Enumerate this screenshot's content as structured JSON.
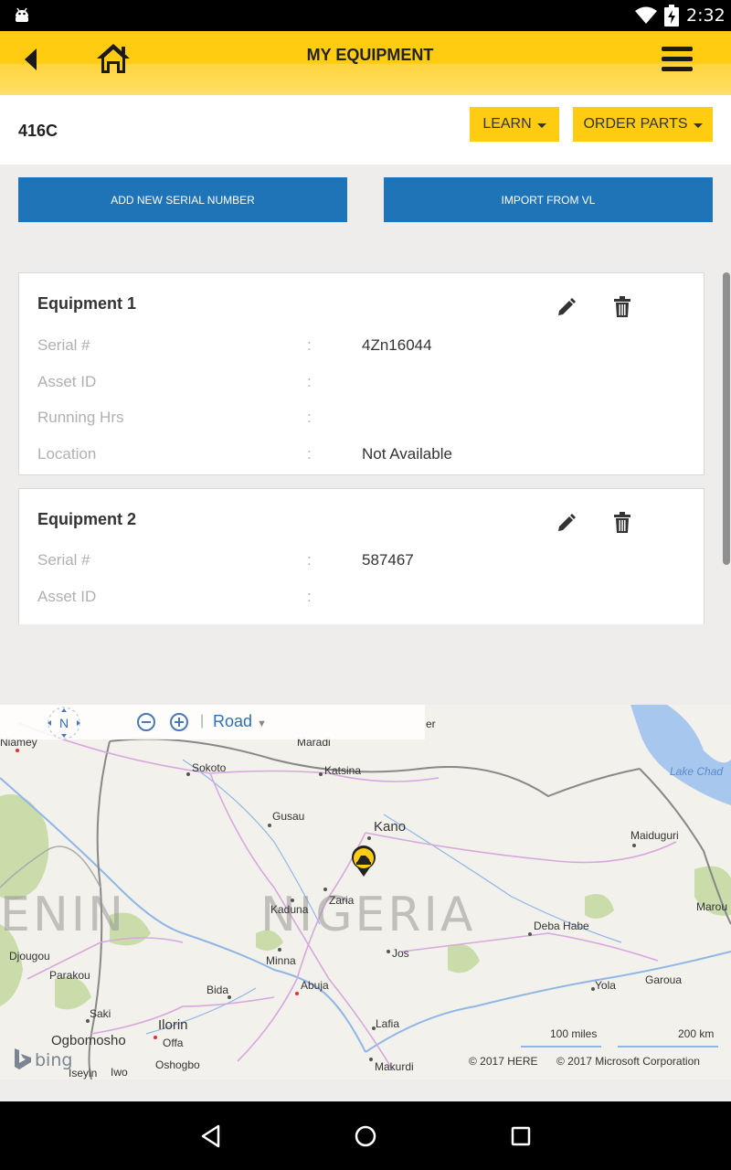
{
  "status_bar": {
    "time": "2:32"
  },
  "header": {
    "title": "MY EQUIPMENT"
  },
  "model": {
    "name": "416C",
    "learn_label": "LEARN",
    "order_parts_label": "ORDER PARTS"
  },
  "actions": {
    "add_serial_label": "ADD NEW SERIAL NUMBER",
    "import_label": "IMPORT FROM VL"
  },
  "equipment": [
    {
      "title": "Equipment 1",
      "rows": [
        {
          "label": "Serial #",
          "value": "4Zn16044"
        },
        {
          "label": "Asset ID",
          "value": ""
        },
        {
          "label": "Running Hrs",
          "value": ""
        },
        {
          "label": "Location",
          "value": "Not Available"
        }
      ]
    },
    {
      "title": "Equipment 2",
      "rows": [
        {
          "label": "Serial #",
          "value": "587467"
        },
        {
          "label": "Asset ID",
          "value": ""
        }
      ]
    }
  ],
  "separator": ":",
  "map": {
    "compass_label": "N",
    "map_type": "Road",
    "country_left": "ENIN",
    "country": "NIGERIA",
    "lake": "Lake Chad",
    "places": {
      "niamey": "Niamey",
      "maradi": "Maradi",
      "zinder": "er",
      "sokoto": "Sokoto",
      "katsina": "Katsina",
      "gusau": "Gusau",
      "kano": "Kano",
      "maiduguri": "Maiduguri",
      "zaria": "Zaria",
      "kaduna": "Kaduna",
      "maroua": "Marou",
      "deba_habe": "Deba Habe",
      "djougou": "Djougou",
      "parakou": "Parakou",
      "minna": "Minna",
      "jos": "Jos",
      "abuja": "Abuja",
      "bida": "Bida",
      "yola": "Yola",
      "garoua": "Garoua",
      "saki": "Saki",
      "ilorin": "Ilorin",
      "lafia": "Lafia",
      "ogbomosho": "Ogbomosho",
      "offa": "Offa",
      "oshogbo": "Oshogbo",
      "makurdi": "Makurdi",
      "iseyin": "Iseyin",
      "iwo": "Iwo"
    },
    "scale_miles": "100 miles",
    "scale_km": "200 km",
    "copyright_here": "© 2017 HERE",
    "copyright_ms": "© 2017 Microsoft Corporation",
    "bing": "bing"
  }
}
